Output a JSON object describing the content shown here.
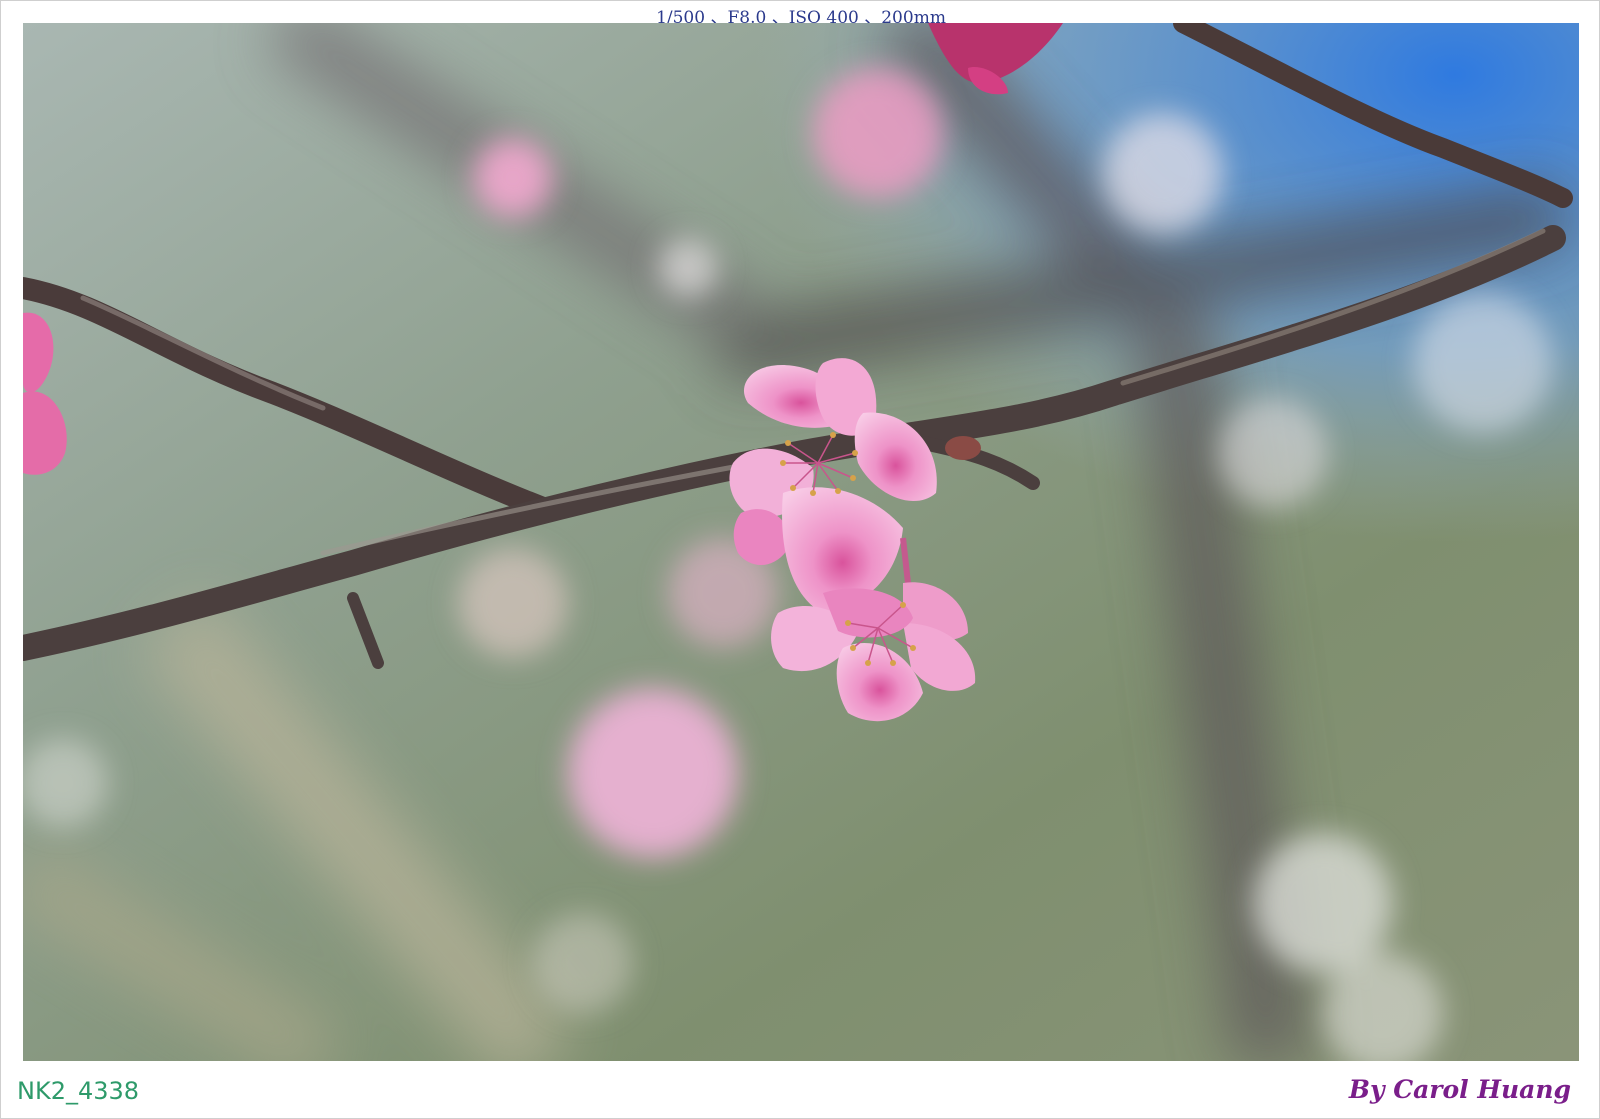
{
  "exif_caption": "1/500 、F8.0 、ISO 400 、200mm",
  "file_id": "NK2_4338",
  "credit": "By Carol Huang",
  "photo": {
    "subject": "pink cherry blossom on a bare branch",
    "colors": {
      "blossom": "#e98cc4",
      "blossom_light": "#f6c4e2",
      "branch": "#4a3b3a",
      "sky": "#3f86dc",
      "background": "#8c9c86"
    }
  }
}
